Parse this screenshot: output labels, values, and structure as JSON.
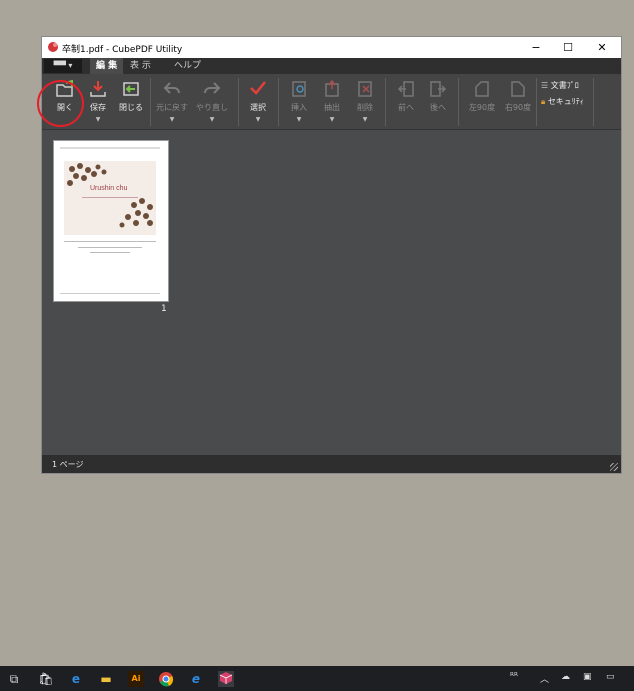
{
  "window": {
    "title": "卒制1.pdf - CubePDF Utility",
    "controls": {
      "minimize": "−",
      "maximize": "☐",
      "close": "✕"
    }
  },
  "ribbon": {
    "file_menu": "▀▀ ▾",
    "tabs": [
      {
        "label": "編 集",
        "active": true
      },
      {
        "label": "表 示",
        "active": false
      },
      {
        "label": "ヘルプ",
        "active": false
      }
    ]
  },
  "toolbar": {
    "open": {
      "label": "開く",
      "icon": "folder-open-icon",
      "enabled": true
    },
    "save": {
      "label": "保存",
      "icon": "save-icon",
      "enabled": true
    },
    "close": {
      "label": "閉じる",
      "icon": "close-file-icon",
      "enabled": true
    },
    "undo": {
      "label": "元に戻す",
      "icon": "undo-icon",
      "enabled": false
    },
    "redo": {
      "label": "やり直し",
      "icon": "redo-icon",
      "enabled": false
    },
    "select": {
      "label": "選択",
      "icon": "checkmark-icon",
      "enabled": true
    },
    "insert": {
      "label": "挿入",
      "icon": "insert-icon",
      "enabled": false
    },
    "extract": {
      "label": "抽出",
      "icon": "extract-icon",
      "enabled": false
    },
    "delete": {
      "label": "削除",
      "icon": "delete-icon",
      "enabled": false
    },
    "previous": {
      "label": "前へ",
      "icon": "move-previous-icon",
      "enabled": false
    },
    "next": {
      "label": "後へ",
      "icon": "move-next-icon",
      "enabled": false
    },
    "rotate_left": {
      "label": "左90度",
      "icon": "rotate-left-icon",
      "enabled": false
    },
    "rotate_right": {
      "label": "右90度",
      "icon": "rotate-right-icon",
      "enabled": false
    },
    "doc_properties": {
      "label": "文書ﾌﾟﾛ",
      "icon": "list-icon"
    },
    "security": {
      "label": "セキュﾘﾃｨ",
      "icon": "lock-icon"
    }
  },
  "pages": [
    {
      "number": "1",
      "thumbnail_title": "Urushin chu"
    }
  ],
  "status": {
    "page_count": "1 ページ"
  },
  "colors": {
    "accent_green": "#7bc24a",
    "accent_red": "#e4403a",
    "highlight_ring": "#e4202a"
  }
}
